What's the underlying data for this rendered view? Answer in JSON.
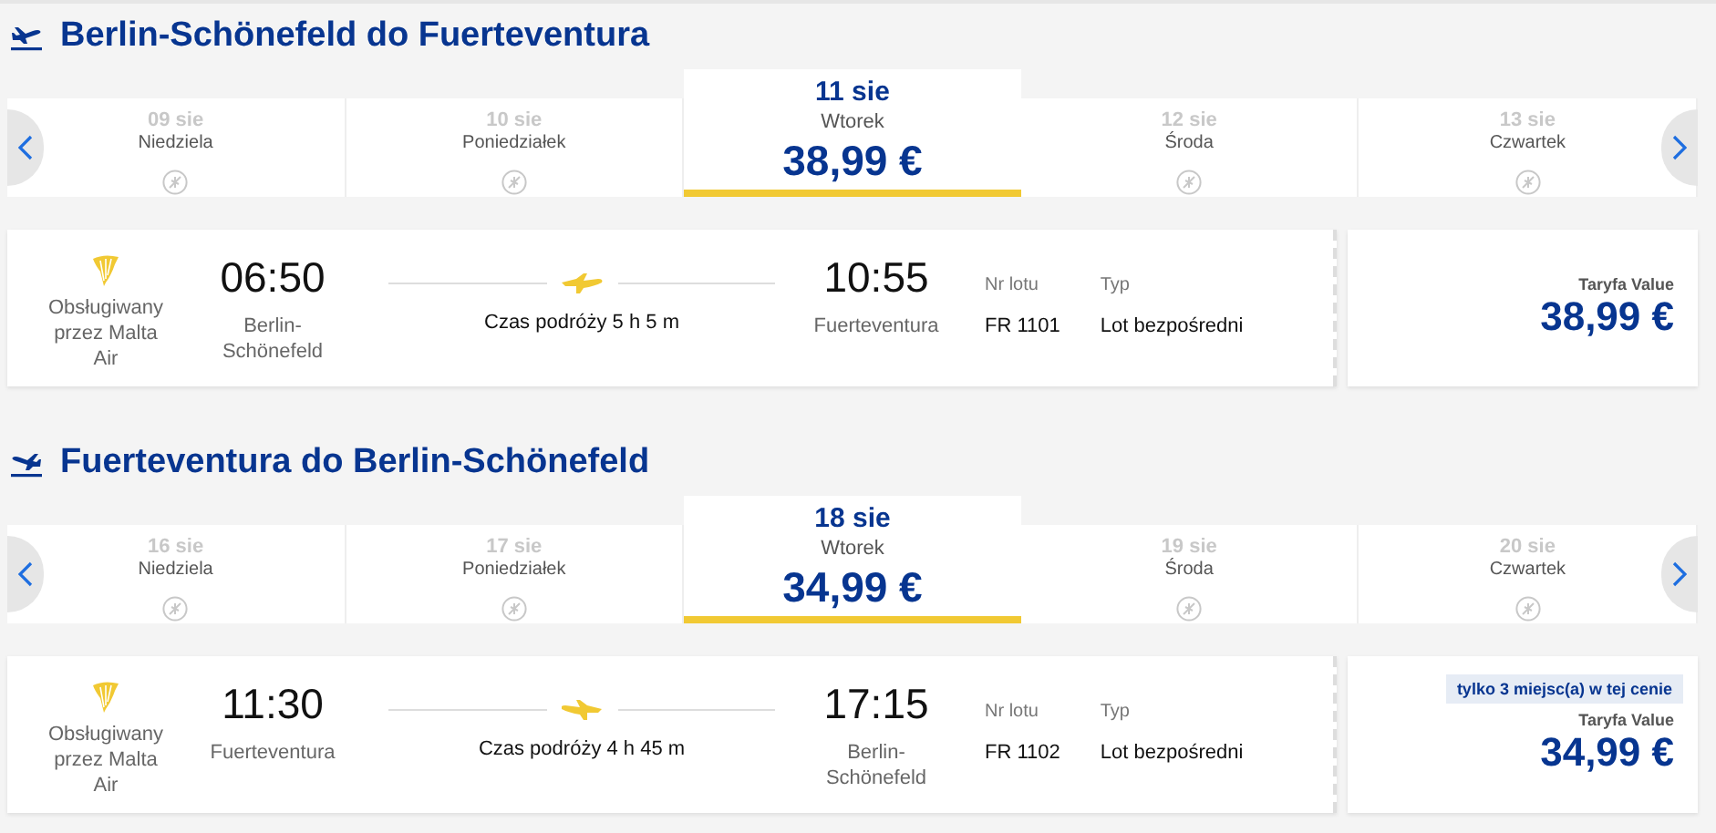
{
  "sections": [
    {
      "kind": "outbound",
      "title": "Berlin-Schönefeld do Fuerteventura",
      "days": [
        {
          "date": "09 sie",
          "weekday": "Niedziela",
          "selected": false
        },
        {
          "date": "10 sie",
          "weekday": "Poniedziałek",
          "selected": false
        },
        {
          "date": "11 sie",
          "weekday": "Wtorek",
          "price": "38,99 €",
          "selected": true
        },
        {
          "date": "12 sie",
          "weekday": "Środa",
          "selected": false
        },
        {
          "date": "13 sie",
          "weekday": "Czwartek",
          "selected": false
        }
      ],
      "flight": {
        "operator": "Obsługiwany przez Malta Air",
        "depart_time": "06:50",
        "depart_airport": "Berlin-Schönefeld",
        "duration": "Czas podróży 5 h 5 m",
        "arrive_time": "10:55",
        "arrive_airport": "Fuerteventura",
        "flight_no_label": "Nr lotu",
        "flight_no": "FR 1101",
        "type_label": "Typ",
        "type": "Lot bezpośredni",
        "fare_label": "Taryfa Value",
        "price": "38,99 €"
      }
    },
    {
      "kind": "return",
      "title": "Fuerteventura do Berlin-Schönefeld",
      "days": [
        {
          "date": "16 sie",
          "weekday": "Niedziela",
          "selected": false
        },
        {
          "date": "17 sie",
          "weekday": "Poniedziałek",
          "selected": false
        },
        {
          "date": "18 sie",
          "weekday": "Wtorek",
          "price": "34,99 €",
          "selected": true
        },
        {
          "date": "19 sie",
          "weekday": "Środa",
          "selected": false
        },
        {
          "date": "20 sie",
          "weekday": "Czwartek",
          "selected": false
        }
      ],
      "flight": {
        "operator": "Obsługiwany przez Malta Air",
        "depart_time": "11:30",
        "depart_airport": "Fuerteventura",
        "duration": "Czas podróży 4 h 45 m",
        "arrive_time": "17:15",
        "arrive_airport": "Berlin-Schönefeld",
        "flight_no_label": "Nr lotu",
        "flight_no": "FR 1102",
        "type_label": "Typ",
        "type": "Lot bezpośredni",
        "badge": "tylko 3 miejsc(a) w tej cenie",
        "fare_label": "Taryfa Value",
        "price": "34,99 €"
      }
    }
  ]
}
